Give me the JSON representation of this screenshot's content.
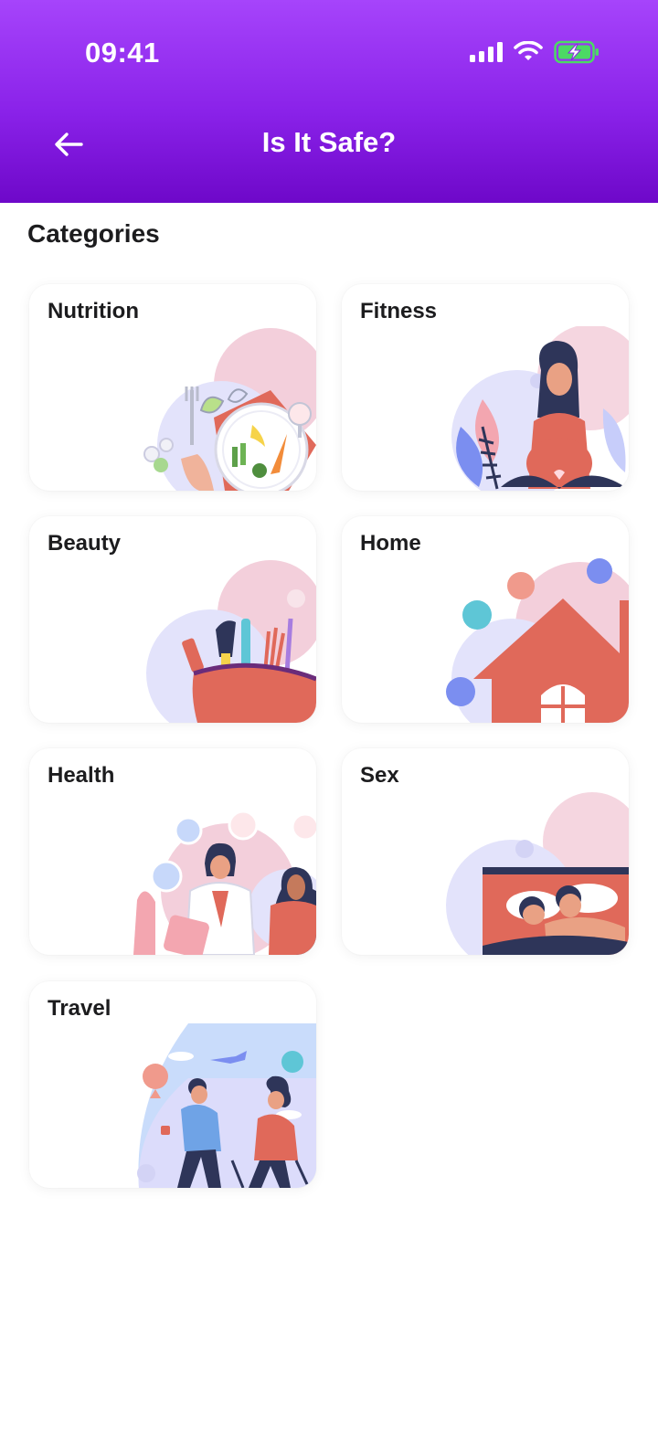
{
  "status_bar": {
    "time": "09:41",
    "icons": [
      "signal-icon",
      "wifi-icon",
      "battery-charging-icon"
    ]
  },
  "header": {
    "title": "Is It Safe?",
    "back_icon": "arrow-left-icon"
  },
  "section": {
    "title": "Categories"
  },
  "categories": [
    {
      "label": "Nutrition",
      "illustration": "nutrition-plate-illustration"
    },
    {
      "label": "Fitness",
      "illustration": "fitness-yoga-illustration"
    },
    {
      "label": "Beauty",
      "illustration": "beauty-cosmetics-illustration"
    },
    {
      "label": "Home",
      "illustration": "home-house-illustration"
    },
    {
      "label": "Health",
      "illustration": "health-doctor-illustration"
    },
    {
      "label": "Sex",
      "illustration": "sex-couple-illustration"
    },
    {
      "label": "Travel",
      "illustration": "travel-couple-illustration"
    }
  ],
  "colors": {
    "header_top": "#a644fb",
    "header_bottom": "#6e08c9",
    "accent_coral": "#e0695a",
    "accent_lavender": "#dcdcfb",
    "accent_pink": "#f3c9d6",
    "battery_green": "#4cd964"
  }
}
